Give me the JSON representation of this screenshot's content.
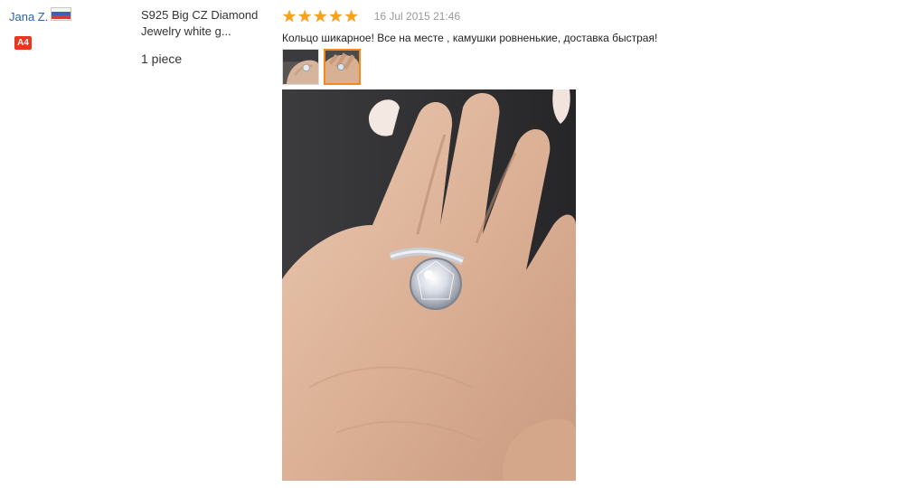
{
  "buyer": {
    "name": "Jana Z.",
    "country_flag_icon": "russia-flag-icon",
    "level_badge": "A4"
  },
  "product": {
    "title_line1": "S925 Big CZ Diamond",
    "title_line2": "Jewelry white g...",
    "quantity": "1 piece"
  },
  "review": {
    "rating": 5,
    "rating_max": 5,
    "stars": [
      "★",
      "★",
      "★",
      "★",
      "★"
    ],
    "date": "16 Jul 2015 21:46",
    "text": "Кольцо шикарное! Все на месте , камушки ровненькие, доставка быстрая!",
    "photos": [
      {
        "name": "review-photo-thumb-1",
        "selected": false
      },
      {
        "name": "review-photo-thumb-2",
        "selected": true
      }
    ]
  },
  "colors": {
    "link": "#2f61a8",
    "badge": "#e8361f",
    "star": "#f7a21b",
    "date": "#999999",
    "thumb_selected_border": "#f38a1b"
  }
}
